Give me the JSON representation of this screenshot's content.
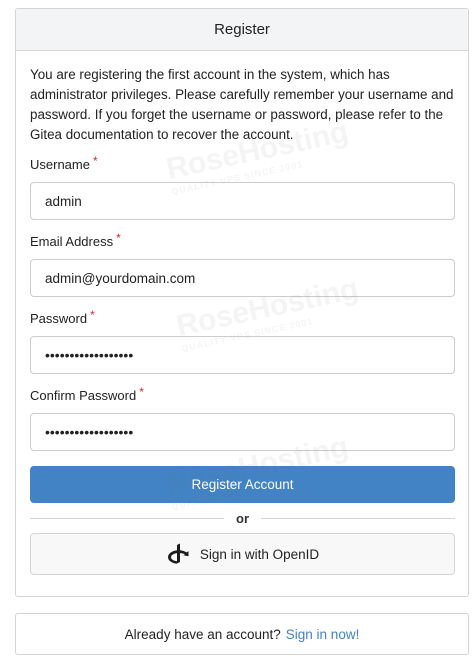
{
  "header": {
    "title": "Register"
  },
  "notice": "You are registering the first account in the system, which has administrator privileges. Please carefully remember your username and password. If you forget the username or password, please refer to the Gitea documentation to recover the account.",
  "fields": [
    {
      "label": "Username",
      "value": "admin",
      "type": "text"
    },
    {
      "label": "Email Address",
      "value": "admin@yourdomain.com",
      "type": "email"
    },
    {
      "label": "Password",
      "value": "••••••••••••••••••",
      "type": "password"
    },
    {
      "label": "Confirm Password",
      "value": "••••••••••••••••••",
      "type": "password"
    }
  ],
  "required_marker": "*",
  "register_button": "Register Account",
  "divider_text": "or",
  "openid_button": "Sign in with OpenID",
  "footer": {
    "text": "Already have an account?",
    "link": "Sign in now!"
  },
  "watermark": {
    "brand": "RoseHosting",
    "tagline": "QUALITY VPS SINCE 2001"
  },
  "colors": {
    "primary": "#4183c4",
    "required": "#db2828",
    "link": "#4183c4"
  }
}
